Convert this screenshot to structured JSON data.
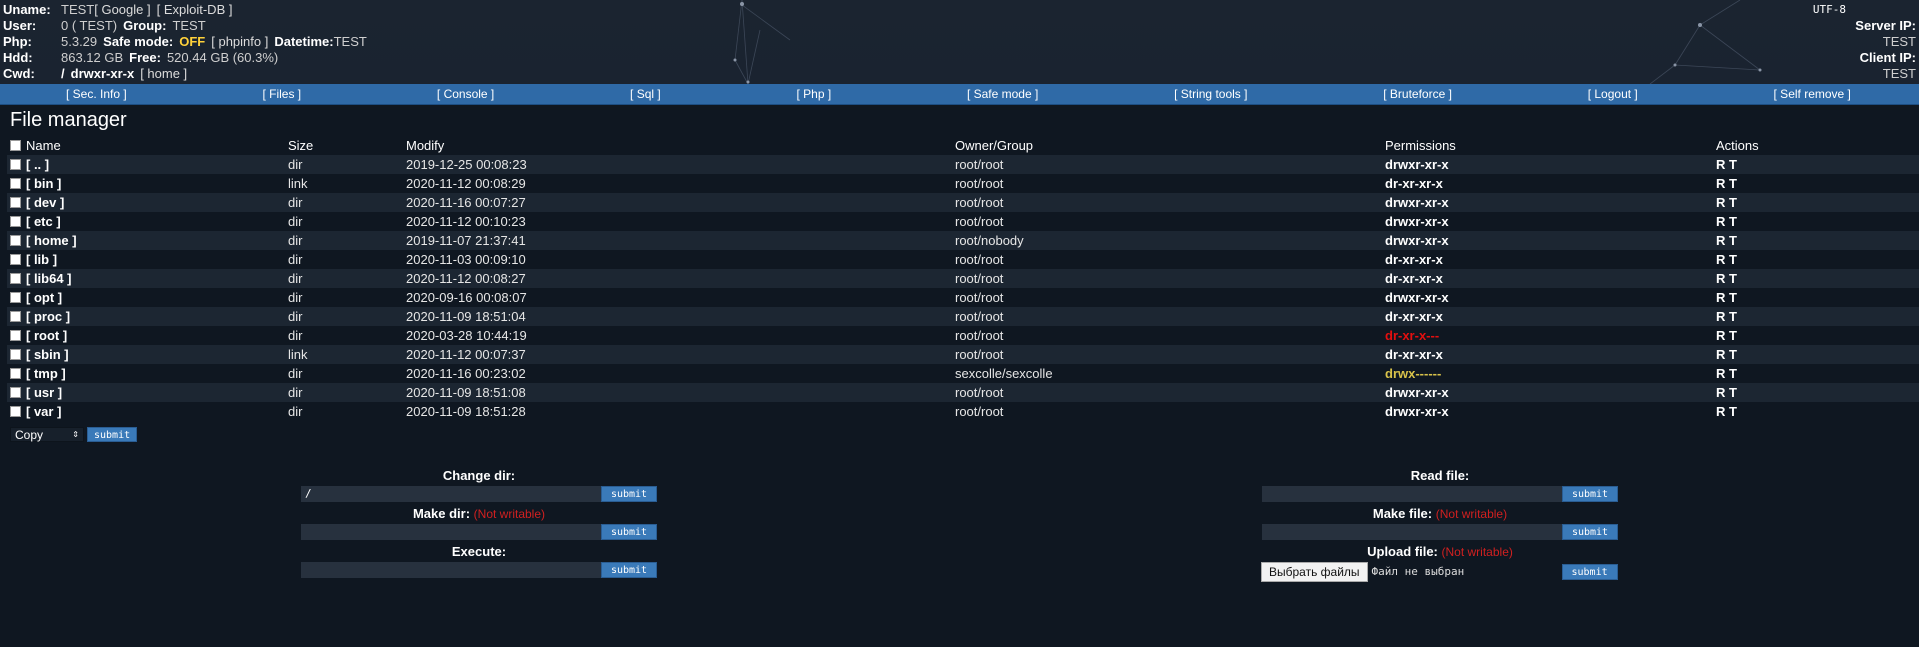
{
  "header": {
    "uname_label": "Uname:",
    "uname_value": "TEST",
    "uname_links": [
      "[ Google ]",
      "[ Exploit-DB ]"
    ],
    "user_label": "User:",
    "user_value": "0 ( TEST)",
    "group_label": "Group:",
    "group_value": "TEST",
    "php_label": "Php:",
    "php_value": "5.3.29",
    "safe_label": "Safe mode:",
    "safe_value": "OFF",
    "phpinfo_link": "[ phpinfo ]",
    "datetime_label": "Datetime:",
    "datetime_value": "TEST",
    "hdd_label": "Hdd:",
    "hdd_value": "863.12 GB",
    "free_label": "Free:",
    "free_value": "520.44 GB (60.3%)",
    "cwd_label": "Cwd:",
    "cwd_path": "/",
    "cwd_perm": "drwxr-xr-x",
    "cwd_home": "[ home ]",
    "encoding": "UTF-8",
    "server_ip_label": "Server IP:",
    "server_ip_value": "TEST",
    "client_ip_label": "Client IP:",
    "client_ip_value": "TEST"
  },
  "menu": [
    "[ Sec. Info ]",
    "[ Files ]",
    "[ Console ]",
    "[ Sql ]",
    "[ Php ]",
    "[ Safe mode ]",
    "[ String tools ]",
    "[ Bruteforce ]",
    "[ Logout ]",
    "[ Self remove ]"
  ],
  "file_manager": {
    "title": "File manager",
    "columns": [
      "Name",
      "Size",
      "Modify",
      "Owner/Group",
      "Permissions",
      "Actions"
    ],
    "rows": [
      {
        "name": "[ .. ]",
        "size": "dir",
        "modify": "2019-12-25 00:08:23",
        "owner": "root/root",
        "perm": "drwxr-xr-x",
        "perm_color": "#ffffff",
        "actions": "R T"
      },
      {
        "name": "[ bin ]",
        "size": "link",
        "modify": "2020-11-12 00:08:29",
        "owner": "root/root",
        "perm": "dr-xr-xr-x",
        "perm_color": "#ffffff",
        "actions": "R T"
      },
      {
        "name": "[ dev ]",
        "size": "dir",
        "modify": "2020-11-16 00:07:27",
        "owner": "root/root",
        "perm": "drwxr-xr-x",
        "perm_color": "#ffffff",
        "actions": "R T"
      },
      {
        "name": "[ etc ]",
        "size": "dir",
        "modify": "2020-11-12 00:10:23",
        "owner": "root/root",
        "perm": "drwxr-xr-x",
        "perm_color": "#ffffff",
        "actions": "R T"
      },
      {
        "name": "[ home ]",
        "size": "dir",
        "modify": "2019-11-07 21:37:41",
        "owner": "root/nobody",
        "perm": "drwxr-xr-x",
        "perm_color": "#ffffff",
        "actions": "R T"
      },
      {
        "name": "[ lib ]",
        "size": "dir",
        "modify": "2020-11-03 00:09:10",
        "owner": "root/root",
        "perm": "dr-xr-xr-x",
        "perm_color": "#ffffff",
        "actions": "R T"
      },
      {
        "name": "[ lib64 ]",
        "size": "dir",
        "modify": "2020-11-12 00:08:27",
        "owner": "root/root",
        "perm": "dr-xr-xr-x",
        "perm_color": "#ffffff",
        "actions": "R T"
      },
      {
        "name": "[ opt ]",
        "size": "dir",
        "modify": "2020-09-16 00:08:07",
        "owner": "root/root",
        "perm": "drwxr-xr-x",
        "perm_color": "#ffffff",
        "actions": "R T"
      },
      {
        "name": "[ proc ]",
        "size": "dir",
        "modify": "2020-11-09 18:51:04",
        "owner": "root/root",
        "perm": "dr-xr-xr-x",
        "perm_color": "#ffffff",
        "actions": "R T"
      },
      {
        "name": "[ root ]",
        "size": "dir",
        "modify": "2020-03-28 10:44:19",
        "owner": "root/root",
        "perm": "dr-xr-x---",
        "perm_color": "#e40f0f",
        "actions": "R T"
      },
      {
        "name": "[ sbin ]",
        "size": "link",
        "modify": "2020-11-12 00:07:37",
        "owner": "root/root",
        "perm": "dr-xr-xr-x",
        "perm_color": "#ffffff",
        "actions": "R T"
      },
      {
        "name": "[ tmp ]",
        "size": "dir",
        "modify": "2020-11-16 00:23:02",
        "owner": "sexcolle/sexcolle",
        "perm": "drwx------",
        "perm_color": "#d9c34a",
        "actions": "R T"
      },
      {
        "name": "[ usr ]",
        "size": "dir",
        "modify": "2020-11-09 18:51:08",
        "owner": "root/root",
        "perm": "drwxr-xr-x",
        "perm_color": "#ffffff",
        "actions": "R T"
      },
      {
        "name": "[ var ]",
        "size": "dir",
        "modify": "2020-11-09 18:51:28",
        "owner": "root/root",
        "perm": "drwxr-xr-x",
        "perm_color": "#ffffff",
        "actions": "R T"
      }
    ],
    "copy_select": "Copy",
    "submit_label": "submit"
  },
  "forms": {
    "change_dir_title": "Change dir:",
    "change_dir_value": "/",
    "make_dir_title": "Make dir:",
    "execute_title": "Execute:",
    "read_file_title": "Read file:",
    "make_file_title": "Make file:",
    "upload_file_title": "Upload file:",
    "not_writable": "(Not writable)",
    "choose_file_button": "Выбрать файлы",
    "no_file_text": "Файл не выбран",
    "submit_label": "submit"
  }
}
